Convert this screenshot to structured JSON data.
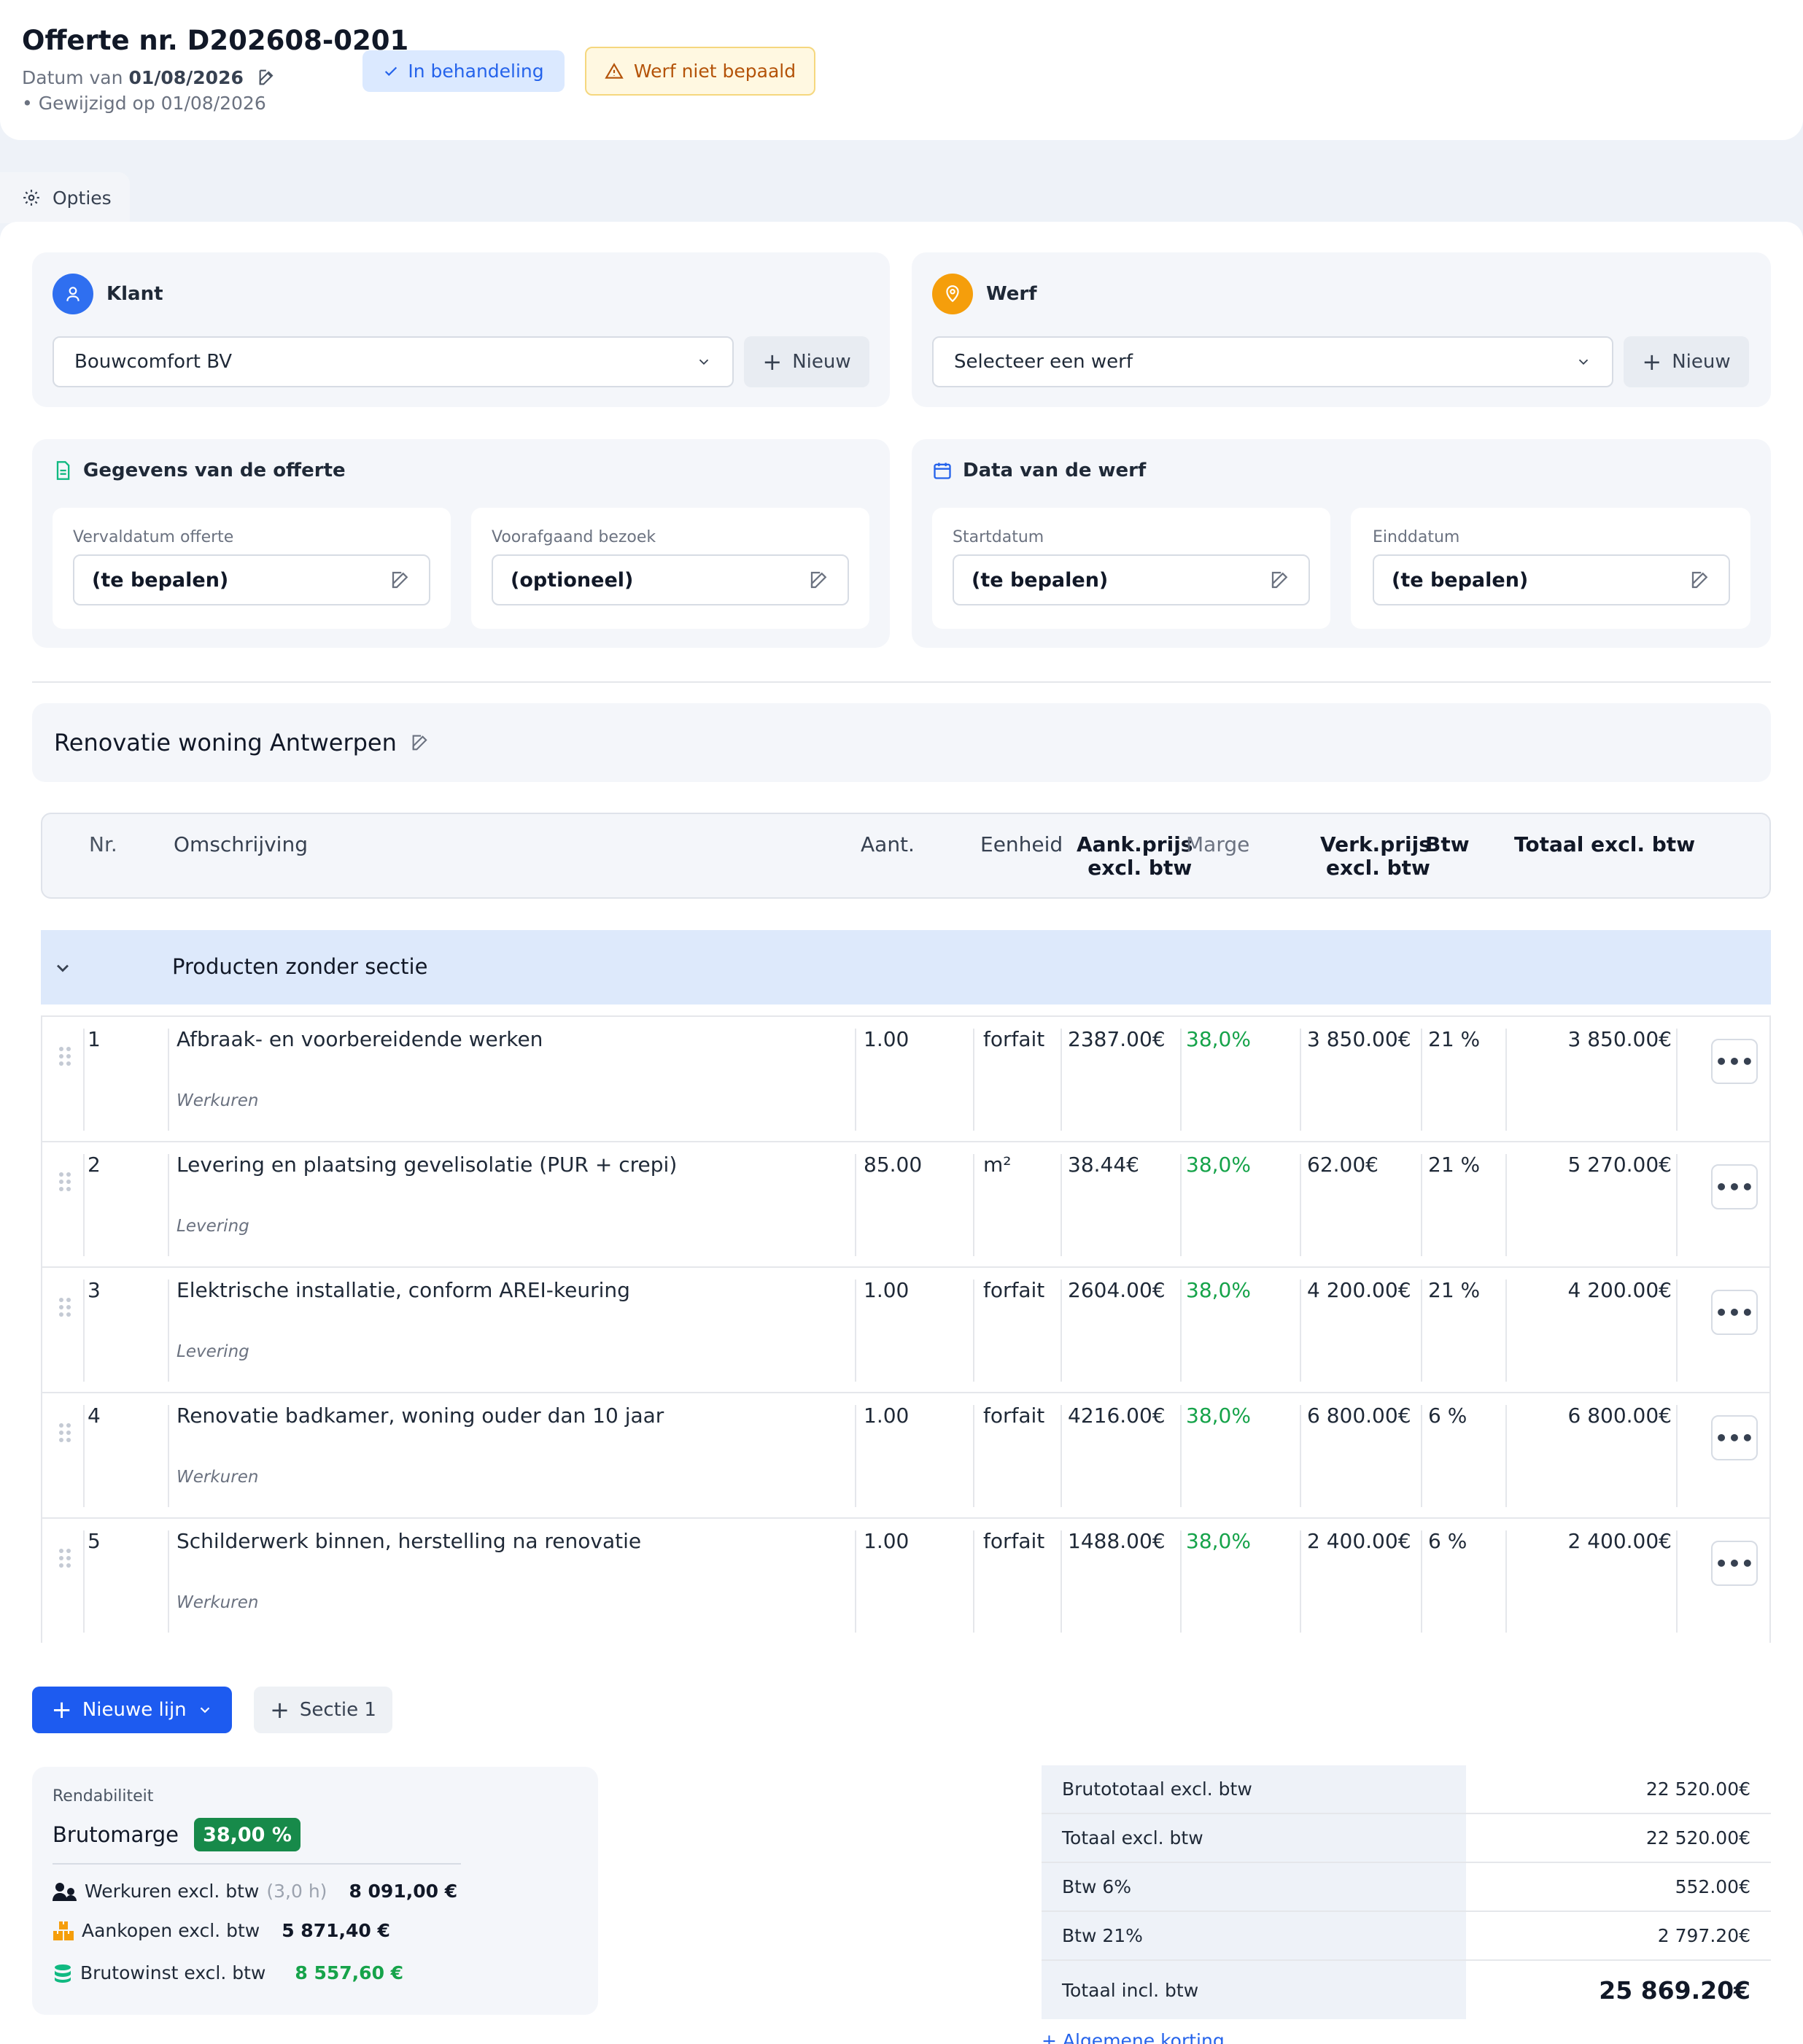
{
  "header": {
    "title": "Offerte nr. D202608-0201",
    "date_prefix": "Datum van",
    "date": "01/08/2026",
    "modified": "• Gewijzigd op 01/08/2026",
    "status_badge": "In behandeling",
    "warning_badge": "Werf niet bepaald"
  },
  "opties_tab": "Opties",
  "klant": {
    "title": "Klant",
    "selected": "Bouwcomfort BV",
    "new_label": "Nieuw"
  },
  "werf": {
    "title": "Werf",
    "placeholder": "Selecteer een werf",
    "new_label": "Nieuw"
  },
  "offerte_data": {
    "title": "Gegevens van de offerte",
    "fields": [
      {
        "label": "Vervaldatum offerte",
        "value": "(te bepalen)"
      },
      {
        "label": "Voorafgaand bezoek",
        "value": "(optioneel)"
      }
    ]
  },
  "werf_data": {
    "title": "Data van de werf",
    "fields": [
      {
        "label": "Startdatum",
        "value": "(te bepalen)"
      },
      {
        "label": "Einddatum",
        "value": "(te bepalen)"
      }
    ]
  },
  "project_title": "Renovatie woning Antwerpen",
  "table": {
    "headers": {
      "nr": "Nr.",
      "omschrijving": "Omschrijving",
      "aant": "Aant.",
      "eenheid": "Eenheid",
      "aankprijs_1": "Aank.prijs",
      "aankprijs_2": "excl. btw",
      "marge": "Marge",
      "verkprijs_1": "Verk.prijs",
      "verkprijs_2": "excl. btw",
      "btw": "Btw",
      "totaal": "Totaal excl. btw"
    },
    "section_name": "Producten zonder sectie",
    "rows": [
      {
        "nr": "1",
        "desc": "Afbraak- en voorbereidende werken",
        "cat": "Werkuren",
        "qty": "1.00",
        "unit": "forfait",
        "buy": "2387.00€",
        "margin": "38,0%",
        "sell": "3 850.00€",
        "vat": "21 %",
        "total": "3 850.00€"
      },
      {
        "nr": "2",
        "desc": "Levering en plaatsing gevelisolatie (PUR + crepi)",
        "cat": "Levering",
        "qty": "85.00",
        "unit": "m²",
        "buy": "38.44€",
        "margin": "38,0%",
        "sell": "62.00€",
        "vat": "21 %",
        "total": "5 270.00€"
      },
      {
        "nr": "3",
        "desc": "Elektrische installatie, conform AREI-keuring",
        "cat": "Levering",
        "qty": "1.00",
        "unit": "forfait",
        "buy": "2604.00€",
        "margin": "38,0%",
        "sell": "4 200.00€",
        "vat": "21 %",
        "total": "4 200.00€"
      },
      {
        "nr": "4",
        "desc": "Renovatie badkamer, woning ouder dan 10 jaar",
        "cat": "Werkuren",
        "qty": "1.00",
        "unit": "forfait",
        "buy": "4216.00€",
        "margin": "38,0%",
        "sell": "6 800.00€",
        "vat": "6 %",
        "total": "6 800.00€"
      },
      {
        "nr": "5",
        "desc": "Schilderwerk binnen, herstelling na renovatie",
        "cat": "Werkuren",
        "qty": "1.00",
        "unit": "forfait",
        "buy": "1488.00€",
        "margin": "38,0%",
        "sell": "2 400.00€",
        "vat": "6 %",
        "total": "2 400.00€"
      }
    ],
    "row_menu": "•••"
  },
  "actions": {
    "new_line": "Nieuwe lijn",
    "section": "Sectie 1"
  },
  "rendabiliteit": {
    "title": "Rendabiliteit",
    "brutomarge_label": "Brutomarge",
    "brutomarge_value": "38,00 %",
    "werkuren_label": "Werkuren excl. btw",
    "werkuren_hours": "(3,0 h)",
    "werkuren_value": "8 091,00 €",
    "aankopen_label": "Aankopen excl. btw",
    "aankopen_value": "5 871,40 €",
    "brutowinst_label": "Brutowinst excl. btw",
    "brutowinst_value": "8 557,60 €"
  },
  "totals": [
    {
      "label": "Brutototaal excl. btw",
      "value": "22 520.00€"
    },
    {
      "label": "Totaal excl. btw",
      "value": "22 520.00€"
    },
    {
      "label": "Btw 6%",
      "value": "552.00€"
    },
    {
      "label": "Btw 21%",
      "value": "2 797.20€"
    }
  ],
  "grand_total": {
    "label": "Totaal incl. btw",
    "value": "25 869.20€"
  },
  "discount_link": "+ Algemene korting",
  "colors": {
    "accent": "#1d5bf0",
    "success": "#16a34a",
    "warning": "#f5a623"
  }
}
